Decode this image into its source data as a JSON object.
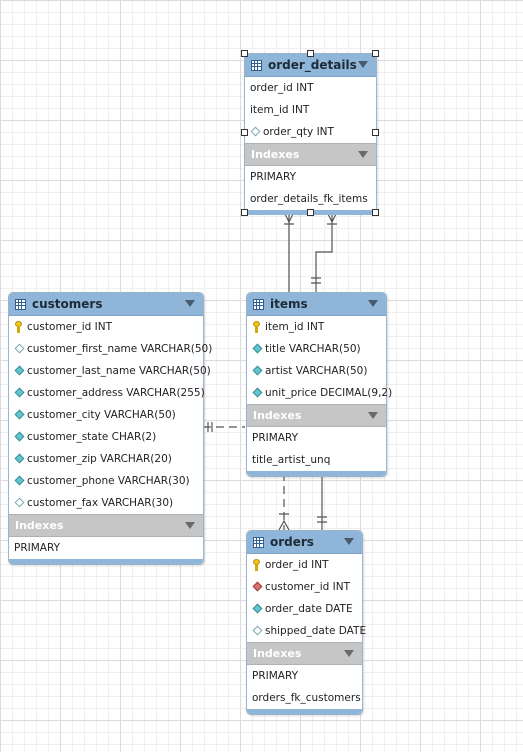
{
  "tables": {
    "order_details": {
      "name": "order_details",
      "columns": [
        {
          "label": "order_id INT",
          "icon": "none"
        },
        {
          "label": "item_id INT",
          "icon": "none"
        },
        {
          "label": "order_qty INT",
          "icon": "nullable-column-icon"
        }
      ],
      "indexes_label": "Indexes",
      "indexes": [
        "PRIMARY",
        "order_details_fk_items"
      ]
    },
    "customers": {
      "name": "customers",
      "columns": [
        {
          "label": "customer_id INT",
          "icon": "primary-key-icon"
        },
        {
          "label": "customer_first_name VARCHAR(50)",
          "icon": "nullable-column-icon"
        },
        {
          "label": "customer_last_name VARCHAR(50)",
          "icon": "not-null-column-icon"
        },
        {
          "label": "customer_address VARCHAR(255)",
          "icon": "not-null-column-icon"
        },
        {
          "label": "customer_city VARCHAR(50)",
          "icon": "not-null-column-icon"
        },
        {
          "label": "customer_state CHAR(2)",
          "icon": "not-null-column-icon"
        },
        {
          "label": "customer_zip VARCHAR(20)",
          "icon": "not-null-column-icon"
        },
        {
          "label": "customer_phone VARCHAR(30)",
          "icon": "not-null-column-icon"
        },
        {
          "label": "customer_fax VARCHAR(30)",
          "icon": "nullable-column-icon"
        }
      ],
      "indexes_label": "Indexes",
      "indexes": [
        "PRIMARY"
      ]
    },
    "items": {
      "name": "items",
      "columns": [
        {
          "label": "item_id INT",
          "icon": "primary-key-icon"
        },
        {
          "label": "title VARCHAR(50)",
          "icon": "not-null-column-icon"
        },
        {
          "label": "artist VARCHAR(50)",
          "icon": "not-null-column-icon"
        },
        {
          "label": "unit_price DECIMAL(9,2)",
          "icon": "not-null-column-icon"
        }
      ],
      "indexes_label": "Indexes",
      "indexes": [
        "PRIMARY",
        "title_artist_unq"
      ]
    },
    "orders": {
      "name": "orders",
      "columns": [
        {
          "label": "order_id INT",
          "icon": "primary-key-icon"
        },
        {
          "label": "customer_id INT",
          "icon": "foreign-key-icon"
        },
        {
          "label": "order_date DATE",
          "icon": "not-null-column-icon"
        },
        {
          "label": "shipped_date DATE",
          "icon": "nullable-column-icon"
        }
      ],
      "indexes_label": "Indexes",
      "indexes": [
        "PRIMARY",
        "orders_fk_customers"
      ]
    }
  },
  "colors": {
    "header": "#8fb6d8",
    "indexes_header": "#c6c6c6",
    "connector": "#555555"
  }
}
